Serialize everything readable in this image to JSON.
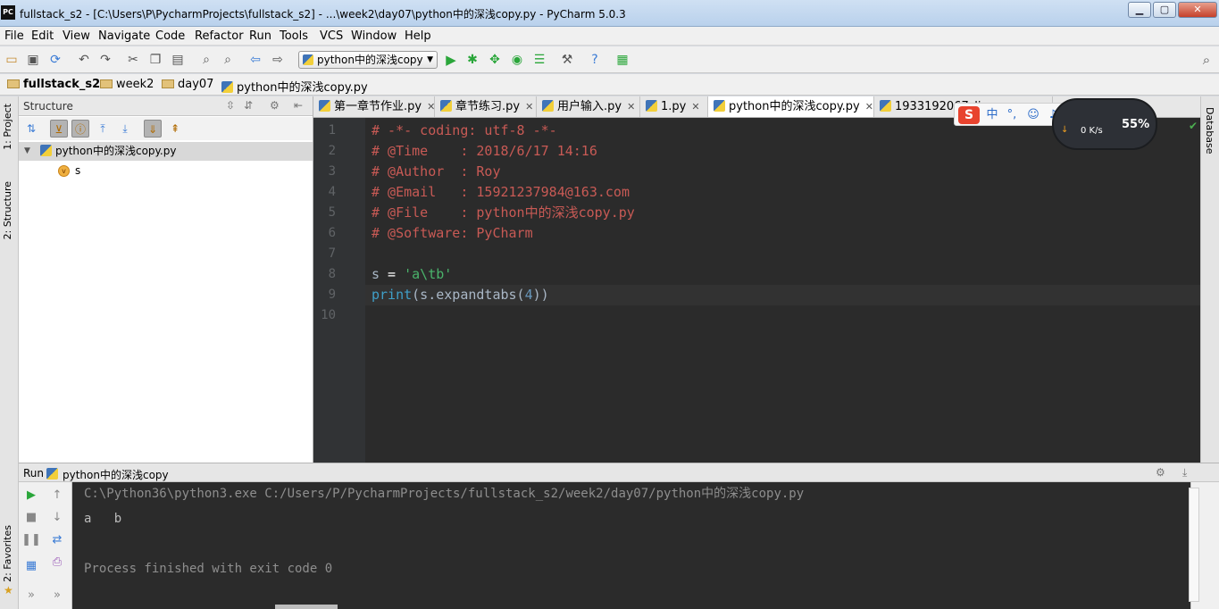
{
  "window": {
    "title": "fullstack_s2 - [C:\\Users\\P\\PycharmProjects\\fullstack_s2] - ...\\week2\\day07\\python中的深浅copy.py - PyCharm 5.0.3",
    "logo_text": "PC",
    "controls": {
      "minimize": "▁",
      "maximize": "▢",
      "close": "✕"
    }
  },
  "menu": [
    "File",
    "Edit",
    "View",
    "Navigate",
    "Code",
    "Refactor",
    "Run",
    "Tools",
    "VCS",
    "Window",
    "Help"
  ],
  "toolbar": {
    "run_config": "python中的深浅copy"
  },
  "breadcrumbs": [
    "fullstack_s2",
    "week2",
    "day07",
    "python中的深浅copy.py"
  ],
  "left_tabs": {
    "project": "1: Project",
    "structure": "2: Structure",
    "favorites": "2: Favorites"
  },
  "right_tabs": {
    "database": "Database"
  },
  "structure": {
    "title": "Structure",
    "root": "python中的深浅copy.py",
    "child": {
      "badge": "v",
      "name": "s"
    }
  },
  "editor_tabs": [
    {
      "label": "第一章节作业.py",
      "active": false
    },
    {
      "label": "章节练习.py",
      "active": false
    },
    {
      "label": "用户输入.py",
      "active": false
    },
    {
      "label": "1.py",
      "active": false
    },
    {
      "label": "python中的深浅copy.py",
      "active": true
    },
    {
      "label": "1933192067_li..",
      "active": false
    }
  ],
  "editor": {
    "line_numbers": [
      "1",
      "2",
      "3",
      "4",
      "5",
      "6",
      "7",
      "8",
      "9",
      "10"
    ],
    "lines": {
      "l1": "# -*- coding: utf-8 -*-",
      "l2": "# @Time    : 2018/6/17 14:16",
      "l3": "# @Author  : Roy",
      "l4": "# @Email   : 15921237984@163.com",
      "l5": "# @File    : python中的深浅copy.py",
      "l6": "# @Software: PyCharm",
      "l8_var": "s",
      "l8_op": " = ",
      "l8_str": "'a\\tb'",
      "l9_kw": "print",
      "l9_mid": "(s.expandtabs(",
      "l9_num": "4",
      "l9_end": "))"
    }
  },
  "ime": {
    "logo": "S",
    "mode": "中",
    "punct": "°,"
  },
  "speed_widget": {
    "speed": "0 K/s",
    "percent": "55%"
  },
  "run": {
    "header_label": "Run",
    "config_name": "python中的深浅copy",
    "console": {
      "command": "C:\\Python36\\python3.exe C:/Users/P/PycharmProjects/fullstack_s2/week2/day07/python中的深浅copy.py",
      "output": "a   b",
      "finished": "Process finished with exit code 0"
    }
  },
  "colors": {
    "editor_bg": "#2b2b2b",
    "comment": "#c85a55",
    "string": "#6a8759",
    "keyword": "#3f9fc8",
    "number": "#6897bb"
  }
}
